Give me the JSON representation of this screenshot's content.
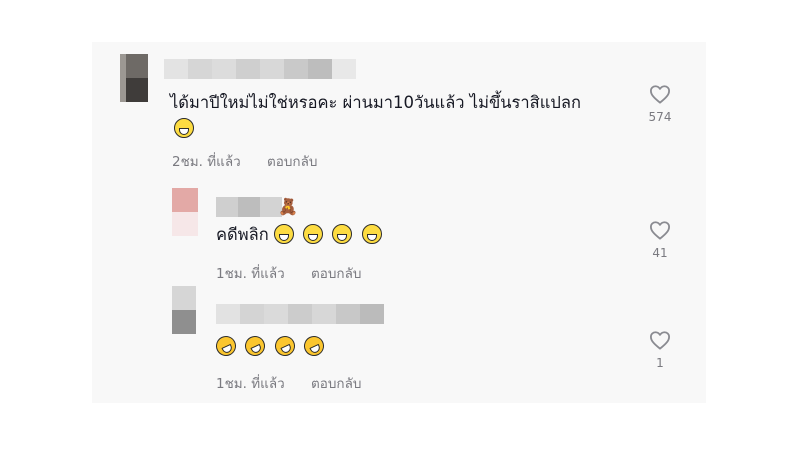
{
  "comments": [
    {
      "text": "ได้มาปีใหม่ไม่ใช่หรอคะ ผ่านมา10วันแล้ว ไม่ขึ้นราสิแปลก",
      "emojis": [
        "grinning-squinting-face"
      ],
      "time": "2ชม. ที่แล้ว",
      "reply_label": "ตอบกลับ",
      "like_count": "574"
    },
    {
      "text": "คดีพลิก",
      "emojis": [
        "grinning-squinting-face",
        "grinning-squinting-face",
        "grinning-squinting-face",
        "grinning-squinting-face"
      ],
      "username_badge": "teddy-bear-icon",
      "time": "1ชม. ที่แล้ว",
      "reply_label": "ตอบกลับ",
      "like_count": "41"
    },
    {
      "text": "",
      "emojis": [
        "rolling-on-floor-laughing",
        "rolling-on-floor-laughing",
        "rolling-on-floor-laughing",
        "rolling-on-floor-laughing"
      ],
      "time": "1ชม. ที่แล้ว",
      "reply_label": "ตอบกลับ",
      "like_count": "1"
    }
  ],
  "colors": {
    "panel": "#f8f8f8",
    "text": "#161823",
    "muted": "#7a7a80",
    "heart_stroke": "#8a8b91"
  }
}
